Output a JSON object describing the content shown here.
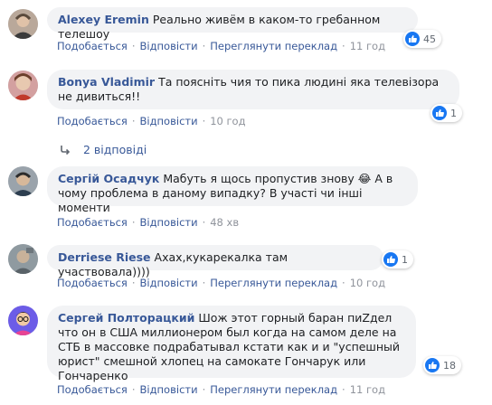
{
  "actions": {
    "like": "Подобається",
    "reply": "Відповісти",
    "translate": "Переглянути переклад",
    "separator": "·"
  },
  "comments": [
    {
      "author": "Alexey Eremin",
      "text": "Реально живём в каком-то гребанном телешоу",
      "time": "11 год",
      "likes": "45",
      "has_translate": true
    },
    {
      "author": "Bonya Vladimir",
      "text": "Та поясніть чия то пика людині яка телевізора не дивиться!!",
      "time": "10 год",
      "likes": "1",
      "has_translate": false
    },
    {
      "author": "Сергій Осадчук",
      "text_before": "Мабуть я щось пропустив знову",
      "emoji": "😂",
      "text_after": "А в чому проблема в даному випадку? В участі чи інші моменти",
      "time": "48 хв",
      "likes": "",
      "has_translate": false
    },
    {
      "author": "Derriese Riese",
      "text": "Ахах,кукарекалка там участвовала))))",
      "time": "10 год",
      "likes": "1",
      "has_translate": true
    },
    {
      "author": "Сергей Полторацкий",
      "text": "Шож этот горный баран пиZдел что он в США миллионером был когда на самом деле на СТБ в массовке подрабатывал кстати как и и \"успешный юрист\" смешной хлопец на самокате Гончарук или Гончаренко",
      "time": "11 год",
      "likes": "18",
      "has_translate": true
    }
  ],
  "replies_toggle": {
    "label": "2 відповіді",
    "icon": "reply-arrow-icon"
  },
  "colors": {
    "link": "#385898",
    "bubble": "#f2f3f5",
    "like": "#1877f2",
    "muted": "#90949c"
  }
}
